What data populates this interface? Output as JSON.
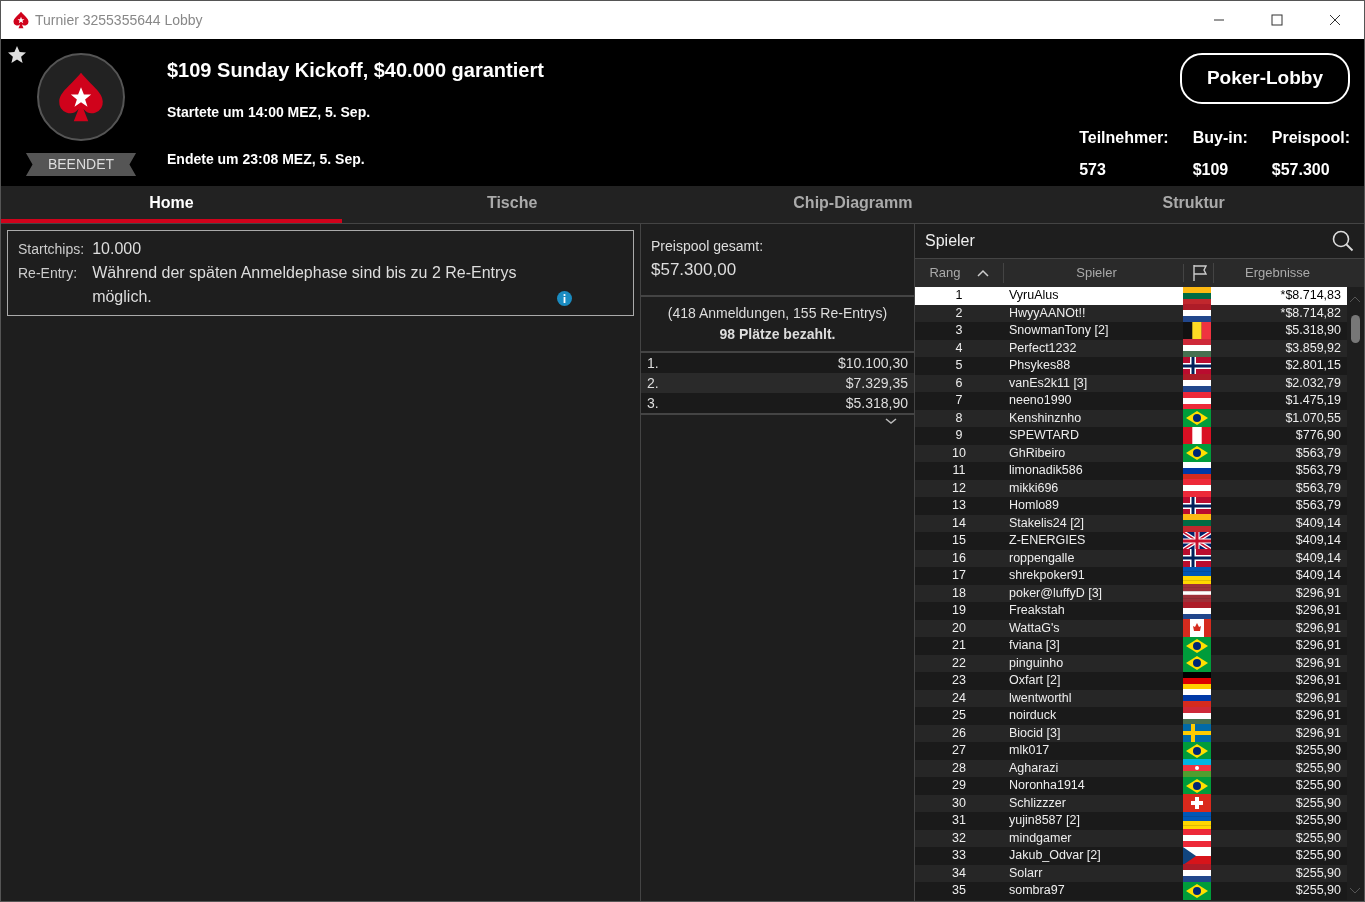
{
  "window": {
    "title": "Turnier 3255355644 Lobby"
  },
  "header": {
    "favorite": false,
    "status": "BEENDET",
    "title": "$109 Sunday Kickoff, $40.000 garantiert",
    "started": "Startete um 14:00 MEZ, 5. Sep.",
    "ended": "Endete um 23:08 MEZ, 5. Sep.",
    "lobby_button": "Poker-Lobby",
    "stats": [
      {
        "label": "Teilnehmer:",
        "value": "573"
      },
      {
        "label": "Buy-in:",
        "value": "$109"
      },
      {
        "label": "Preispool:",
        "value": "$57.300"
      }
    ]
  },
  "tabs": [
    {
      "label": "Home",
      "selected": true
    },
    {
      "label": "Tische",
      "selected": false
    },
    {
      "label": "Chip-Diagramm",
      "selected": false
    },
    {
      "label": "Struktur",
      "selected": false
    }
  ],
  "info": [
    {
      "label": "Startchips:",
      "value": "10.000",
      "info_icon": false
    },
    {
      "label": "Re-Entry:",
      "value": "Während der späten Anmeldephase sind bis zu 2 Re-Entrys möglich.",
      "info_icon": true
    }
  ],
  "prizepool": {
    "label": "Preispool gesamt:",
    "total": "$57.300,00",
    "entries": "(418 Anmeldungen, 155 Re-Entrys)",
    "paid": "98 Plätze bezahlt.",
    "places": [
      {
        "place": "1.",
        "amount": "$10.100,30"
      },
      {
        "place": "2.",
        "amount": "$7.329,35"
      },
      {
        "place": "3.",
        "amount": "$5.318,90"
      }
    ]
  },
  "players": {
    "title": "Spieler",
    "columns": [
      "Rang",
      "Spieler",
      "Ergebnisse"
    ],
    "rows": [
      {
        "rank": "1",
        "name": "VyruAlus",
        "kind": "lt",
        "result": "*$8.714,83",
        "selected": true
      },
      {
        "rank": "2",
        "name": "HwyyAANOt!!",
        "kind": "nl",
        "result": "*$8.714,82",
        "selected": false
      },
      {
        "rank": "3",
        "name": "SnowmanTony [2]",
        "kind": "be",
        "result": "$5.318,90",
        "selected": false
      },
      {
        "rank": "4",
        "name": "Perfect1232",
        "kind": "hu",
        "result": "$3.859,92",
        "selected": false
      },
      {
        "rank": "5",
        "name": "Phsykes88",
        "kind": "no",
        "result": "$2.801,15",
        "selected": false
      },
      {
        "rank": "6",
        "name": "vanEs2k11 [3]",
        "kind": "nl",
        "result": "$2.032,79",
        "selected": false
      },
      {
        "rank": "7",
        "name": "neeno1990",
        "kind": "at",
        "result": "$1.475,19",
        "selected": false
      },
      {
        "rank": "8",
        "name": "Kenshinznho",
        "kind": "br",
        "result": "$1.070,55",
        "selected": false
      },
      {
        "rank": "9",
        "name": "SPEWTARD",
        "kind": "pe",
        "result": "$776,90",
        "selected": false
      },
      {
        "rank": "10",
        "name": "GhRibeiro",
        "kind": "br",
        "result": "$563,79",
        "selected": false
      },
      {
        "rank": "11",
        "name": "limonadik586",
        "kind": "ru",
        "result": "$563,79",
        "selected": false
      },
      {
        "rank": "12",
        "name": "mikki696",
        "kind": "at",
        "result": "$563,79",
        "selected": false
      },
      {
        "rank": "13",
        "name": "Homlo89",
        "kind": "no",
        "result": "$563,79",
        "selected": false
      },
      {
        "rank": "14",
        "name": "Stakelis24 [2]",
        "kind": "lt",
        "result": "$409,14",
        "selected": false
      },
      {
        "rank": "15",
        "name": "Z-ENERGIES",
        "kind": "gb",
        "result": "$409,14",
        "selected": false
      },
      {
        "rank": "16",
        "name": "roppengalle",
        "kind": "no",
        "result": "$409,14",
        "selected": false
      },
      {
        "rank": "17",
        "name": "shrekpoker91",
        "kind": "ua",
        "result": "$409,14",
        "selected": false
      },
      {
        "rank": "18",
        "name": "poker@luffyD [3]",
        "kind": "lv",
        "result": "$296,91",
        "selected": false
      },
      {
        "rank": "19",
        "name": "Freakstah",
        "kind": "nl",
        "result": "$296,91",
        "selected": false
      },
      {
        "rank": "20",
        "name": "WattaG's",
        "kind": "ca",
        "result": "$296,91",
        "selected": false
      },
      {
        "rank": "21",
        "name": "fviana [3]",
        "kind": "br",
        "result": "$296,91",
        "selected": false
      },
      {
        "rank": "22",
        "name": "pinguinho",
        "kind": "br",
        "result": "$296,91",
        "selected": false
      },
      {
        "rank": "23",
        "name": "Oxfart [2]",
        "kind": "de",
        "result": "$296,91",
        "selected": false
      },
      {
        "rank": "24",
        "name": "lwentworthl",
        "kind": "ru",
        "result": "$296,91",
        "selected": false
      },
      {
        "rank": "25",
        "name": "noirduck",
        "kind": "hu",
        "result": "$296,91",
        "selected": false
      },
      {
        "rank": "26",
        "name": "Biocid [3]",
        "kind": "se",
        "result": "$296,91",
        "selected": false
      },
      {
        "rank": "27",
        "name": "mlk017",
        "kind": "br",
        "result": "$255,90",
        "selected": false
      },
      {
        "rank": "28",
        "name": "Agharazi",
        "kind": "az",
        "result": "$255,90",
        "selected": false
      },
      {
        "rank": "29",
        "name": "Noronha1914",
        "kind": "br",
        "result": "$255,90",
        "selected": false
      },
      {
        "rank": "30",
        "name": "Schlizzzer",
        "kind": "ch",
        "result": "$255,90",
        "selected": false
      },
      {
        "rank": "31",
        "name": "yujin8587 [2]",
        "kind": "ua",
        "result": "$255,90",
        "selected": false
      },
      {
        "rank": "32",
        "name": "mindgamer",
        "kind": "at",
        "result": "$255,90",
        "selected": false
      },
      {
        "rank": "33",
        "name": "Jakub_Odvar [2]",
        "kind": "cz",
        "result": "$255,90",
        "selected": false
      },
      {
        "rank": "34",
        "name": "Solarr",
        "kind": "nl",
        "result": "$255,90",
        "selected": false
      },
      {
        "rank": "35",
        "name": "sombra97",
        "kind": "br",
        "result": "$255,90",
        "selected": false
      }
    ]
  }
}
